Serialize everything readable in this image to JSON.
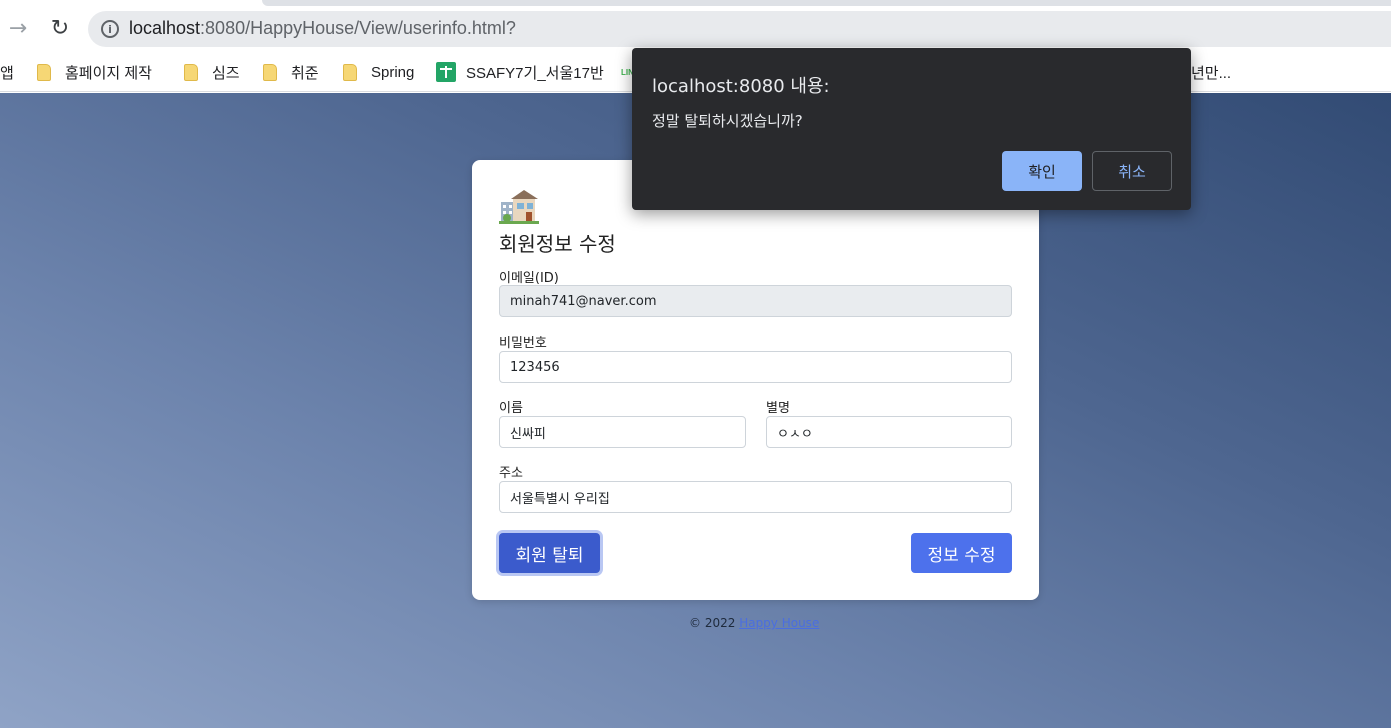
{
  "browser": {
    "url_host": "localhost",
    "url_path": ":8080/HappyHouse/View/userinfo.html?",
    "bookmarks": [
      {
        "label": "앱",
        "icon": "apps-icon"
      },
      {
        "label": "홈페이지 제작",
        "icon": "folder-icon"
      },
      {
        "label": "심즈",
        "icon": "folder-icon"
      },
      {
        "label": "취준",
        "icon": "folder-icon"
      },
      {
        "label": "Spring",
        "icon": "folder-icon"
      },
      {
        "label": "SSAFY7기_서울17반",
        "icon": "sheets-icon"
      },
      {
        "label": "LIN",
        "icon": "line-icon"
      },
      {
        "label": "년만...",
        "icon": "bookmark-icon"
      }
    ]
  },
  "dialog": {
    "title": "localhost:8080 내용:",
    "message": "정말 탈퇴하시겠습니까?",
    "ok_label": "확인",
    "cancel_label": "취소"
  },
  "form": {
    "title": "회원정보 수정",
    "email_label": "이메일(ID)",
    "email_value": "minah741@naver.com",
    "password_label": "비밀번호",
    "password_value": "123456",
    "name_label": "이름",
    "name_value": "신싸피",
    "nickname_label": "별명",
    "nickname_value": "ㅇㅅㅇ",
    "address_label": "주소",
    "address_value": "서울특별시 우리집",
    "withdraw_label": "회원 탈퇴",
    "update_label": "정보 수정"
  },
  "footer": {
    "copyright": "© 2022",
    "link": "Happy House"
  },
  "colors": {
    "primary": "#4d71ec",
    "dialog_bg": "#292a2d",
    "dialog_accent": "#8ab4f8"
  }
}
